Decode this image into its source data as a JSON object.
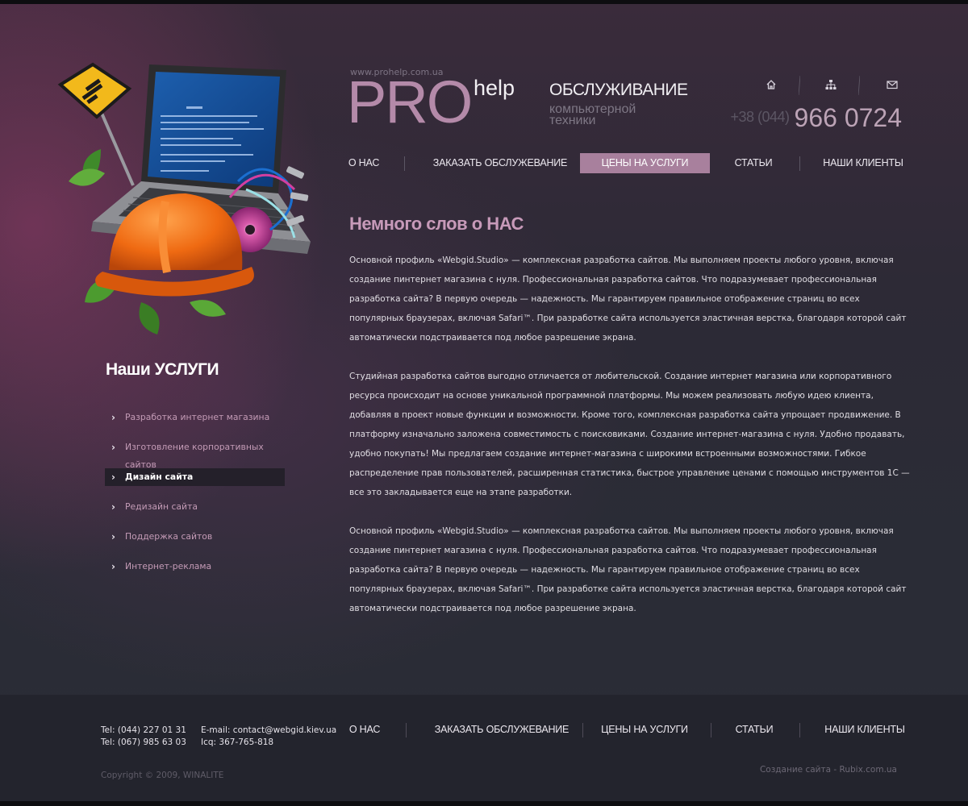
{
  "header": {
    "url": "www.prohelp.com.ua",
    "logo_pro": "PRO",
    "logo_help": "help",
    "tagline_main": "ОБСЛУЖИВАНИЕ",
    "tagline_sub": "компьютерной техники",
    "phone_code": "+38 (044)",
    "phone_number": "966  0724"
  },
  "nav": {
    "items": [
      "О НАС",
      "ЗАКАЗАТЬ ОБСЛУЖЕВАНИЕ",
      "ЦЕНЫ НА УСЛУГИ",
      "СТАТЬИ",
      "НАШИ КЛИЕНТЫ"
    ],
    "active": "ЦЕНЫ НА УСЛУГИ"
  },
  "icons": [
    "home-icon",
    "sitemap-icon",
    "mail-icon"
  ],
  "services": {
    "title": "Наши УСЛУГИ",
    "items": [
      "Разработка интернет магазина",
      "Изготовление корпоративных сайтов",
      "Дизайн сайта",
      "Редизайн сайта",
      "Поддержка сайтов",
      "Интернет-реклама"
    ],
    "active": "Дизайн сайта"
  },
  "content": {
    "title": "Немного слов о НАС",
    "paragraphs": [
      "Основной профиль «Webgid.Studio» — комплексная разработка сайтов. Мы выполняем проекты любого уровня, включая создание пинтернет магазина с нуля. Профессиональная разработка сайтов. Что подразумевает профессиональная разработка сайта? В первую очередь — надежность. Мы гарантируем правильное отображение страниц во всех популярных браузерах, включая Safari™. При разработке сайта используется эластичная верстка, благодаря которой сайт автоматически подстраивается под любое разрешение экрана.",
      "Студийная разработка сайтов выгодно отличается от любительской. Создание интернет магазина или корпоративного ресурса происходит на основе уникальной программной платформы. Мы можем реализовать любую идею клиента, добавляя в проект новые функции и возможности. Кроме того, комплексная разработка сайта упрощает продвижение. В платформу изначально заложена совместимость с поисковиками. Создание интернет-магазина с нуля. Удобно продавать, удобно покупать! Мы предлагаем создание интернет-магазина с широкими встроенными возможностями. Гибкое распределение прав пользователей, расширенная статистика, быстрое управление ценами с помощью инструментов 1С — все это закладывается еще на этапе разработки.",
      "Основной профиль «Webgid.Studio» — комплексная разработка сайтов. Мы выполняем проекты любого уровня, включая создание пинтернет магазина с нуля. Профессиональная разработка сайтов. Что подразумевает профессиональная разработка сайта? В первую очередь — надежность. Мы гарантируем правильное отображение страниц во всех популярных браузерах, включая Safari™. При разработке сайта используется эластичная верстка, благодаря которой сайт автоматически подстраивается под любое разрешение экрана."
    ]
  },
  "footer": {
    "tel1": "Tel: (044) 227 01 31",
    "tel2": "Tel: (067) 985 63 03",
    "email": "E-mail: contact@webgid.kiev.ua",
    "icq": "Icq: 367-765-818",
    "nav": [
      "О НАС",
      "ЗАКАЗАТЬ ОБСЛУЖЕВАНИЕ",
      "ЦЕНЫ НА УСЛУГИ",
      "СТАТЬИ",
      "НАШИ КЛИЕНТЫ"
    ],
    "copyright": "Copyright © 2009, WINALITE",
    "credit_text": "Создание сайта -",
    "credit_link": "Rubix.com.ua"
  },
  "colors": {
    "accent": "#a8809d",
    "title_pink": "#c79ab9",
    "logo_pink": "#b48aa9",
    "background": "#2b2d36"
  }
}
